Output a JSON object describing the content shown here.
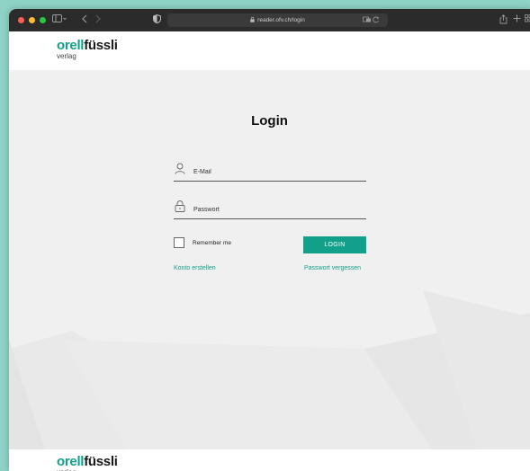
{
  "browser": {
    "url": "reader.ofv.ch/login"
  },
  "header": {
    "logo_word1": "orell",
    "logo_word2": "füssli",
    "logo_sub": "verlag"
  },
  "login": {
    "title": "Login",
    "email_placeholder": "E-Mail",
    "password_placeholder": "Passwort",
    "remember_label": "Remember me",
    "login_button": "LOGIN",
    "create_account": "Konto erstellen",
    "forgot_password": "Passwort vergessen"
  },
  "footer": {
    "logo_word1": "orell",
    "logo_word2": "füssli",
    "logo_sub": "verlag"
  },
  "colors": {
    "accent": "#13a08a",
    "background": "#f0f0f0",
    "desktop": "#8fd3c6"
  },
  "icons": {
    "user": "user-icon",
    "lock": "lock-icon"
  }
}
